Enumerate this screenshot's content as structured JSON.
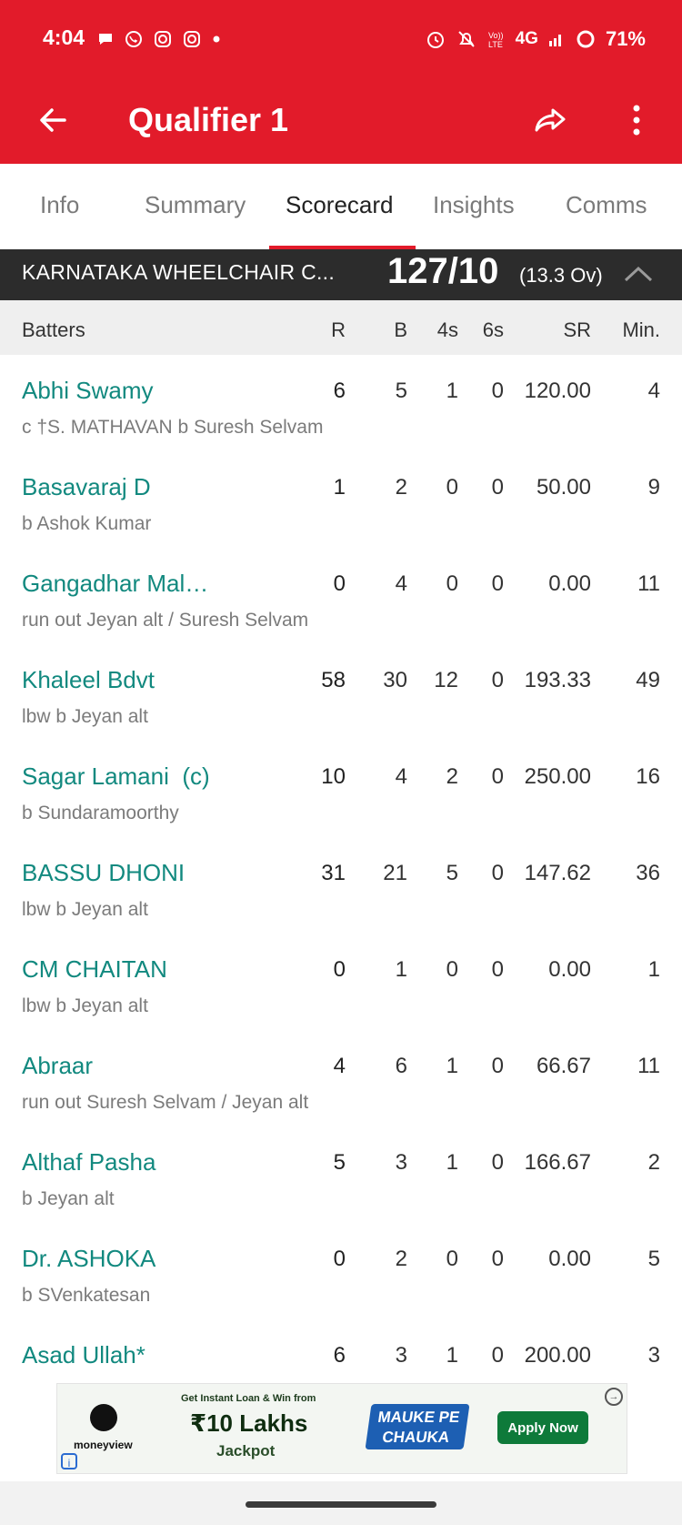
{
  "status_bar": {
    "time": "4:04",
    "left_icons": [
      "chat-bubble-icon",
      "whatsapp-icon",
      "instagram-icon",
      "instagram-icon",
      "dot-icon"
    ],
    "right_icons": [
      "alarm-icon",
      "mute-icon",
      "volte-icon",
      "network-4g-icon",
      "signal-icon",
      "battery-ring-icon"
    ],
    "network": "4G",
    "battery": "71%"
  },
  "toolbar": {
    "title": "Qualifier 1",
    "accent": "#E21B2A"
  },
  "tabs": [
    {
      "label": "Info",
      "active": false
    },
    {
      "label": "Summary",
      "active": false
    },
    {
      "label": "Scorecard",
      "active": true
    },
    {
      "label": "Insights",
      "active": false
    },
    {
      "label": "Comms",
      "active": false
    }
  ],
  "innings": {
    "team": "KARNATAKA WHEELCHAIR C...",
    "score": "127/10",
    "overs": "(13.3 Ov)"
  },
  "table": {
    "headers": {
      "batters": "Batters",
      "r": "R",
      "b": "B",
      "fours": "4s",
      "sixes": "6s",
      "sr": "SR",
      "min": "Min."
    },
    "rows": [
      {
        "name": "Abhi Swamy",
        "dismissal": "c †S. MATHAVAN b Suresh Selvam",
        "r": "6",
        "b": "5",
        "fours": "1",
        "sixes": "0",
        "sr": "120.00",
        "min": "4"
      },
      {
        "name": "Basavaraj D",
        "dismissal": "b Ashok Kumar",
        "r": "1",
        "b": "2",
        "fours": "0",
        "sixes": "0",
        "sr": "50.00",
        "min": "9"
      },
      {
        "name": "Gangadhar Mal…",
        "dismissal": "run out Jeyan alt / Suresh Selvam",
        "r": "0",
        "b": "4",
        "fours": "0",
        "sixes": "0",
        "sr": "0.00",
        "min": "11"
      },
      {
        "name": "Khaleel Bdvt",
        "dismissal": "lbw b Jeyan alt",
        "r": "58",
        "b": "30",
        "fours": "12",
        "sixes": "0",
        "sr": "193.33",
        "min": "49"
      },
      {
        "name": "Sagar Lamani  (c)",
        "dismissal": "b Sundaramoorthy",
        "r": "10",
        "b": "4",
        "fours": "2",
        "sixes": "0",
        "sr": "250.00",
        "min": "16"
      },
      {
        "name": "BASSU DHONI",
        "dismissal": "lbw b Jeyan alt",
        "r": "31",
        "b": "21",
        "fours": "5",
        "sixes": "0",
        "sr": "147.62",
        "min": "36"
      },
      {
        "name": "CM CHAITAN",
        "dismissal": "lbw b Jeyan alt",
        "r": "0",
        "b": "1",
        "fours": "0",
        "sixes": "0",
        "sr": "0.00",
        "min": "1"
      },
      {
        "name": "Abraar",
        "dismissal": "run out Suresh Selvam / Jeyan alt",
        "r": "4",
        "b": "6",
        "fours": "1",
        "sixes": "0",
        "sr": "66.67",
        "min": "11"
      },
      {
        "name": "Althaf Pasha",
        "dismissal": "b Jeyan alt",
        "r": "5",
        "b": "3",
        "fours": "1",
        "sixes": "0",
        "sr": "166.67",
        "min": "2"
      },
      {
        "name": "Dr. ASHOKA",
        "dismissal": "b SVenkatesan",
        "r": "0",
        "b": "2",
        "fours": "0",
        "sixes": "0",
        "sr": "0.00",
        "min": "5"
      },
      {
        "name": "Asad Ullah*",
        "dismissal": "",
        "r": "6",
        "b": "3",
        "fours": "1",
        "sixes": "0",
        "sr": "200.00",
        "min": "3"
      }
    ]
  },
  "ad": {
    "brand": "moneyview",
    "headline": "Get Instant Loan & Win from",
    "amount": "₹10 Lakhs",
    "jackpot": "Jackpot",
    "badge": "MAUKE PE CHAUKA",
    "cta": "Apply Now"
  }
}
